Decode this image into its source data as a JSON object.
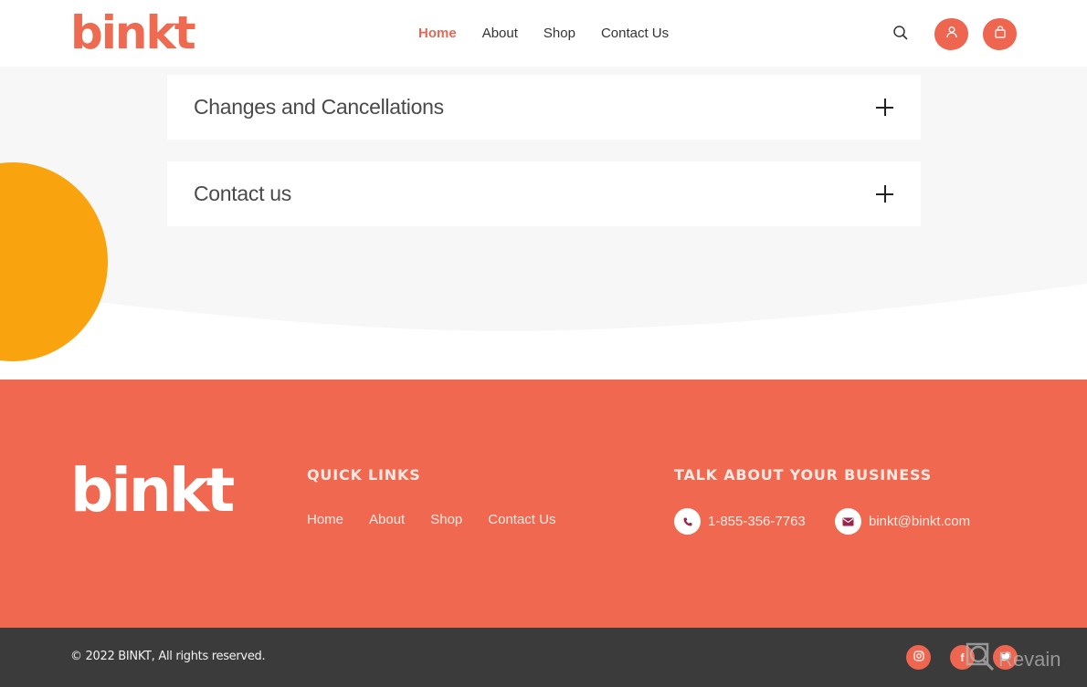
{
  "header": {
    "logo": "binkt",
    "nav": [
      {
        "label": "Home",
        "active": true
      },
      {
        "label": "About",
        "active": false
      },
      {
        "label": "Shop",
        "active": false
      },
      {
        "label": "Contact Us",
        "active": false
      }
    ],
    "icons": [
      "search-icon",
      "user-icon",
      "shopping-bag-icon"
    ]
  },
  "faq": {
    "items": [
      {
        "title": "Changes and Cancellations",
        "icon": "plus-icon"
      },
      {
        "title": "Contact us",
        "icon": "plus-icon"
      }
    ]
  },
  "footer": {
    "logo": "binkt",
    "quick_links": {
      "title": "QUICK LINKS",
      "links": [
        "Home",
        "About",
        "Shop",
        "Contact Us"
      ]
    },
    "business": {
      "title": "TALK ABOUT YOUR BUSINESS",
      "phone": "1-855-356-7763",
      "email": "binkt@binkt.com"
    },
    "copyright": "© 2022 BINKT, All rights reserved.",
    "social": [
      "instagram-icon",
      "facebook-icon",
      "twitter-icon"
    ],
    "watermark": "Revain"
  },
  "colors": {
    "brand": "#ee6650",
    "accent_blob": "#f9a40e",
    "footer_bg": "#f0684f",
    "bottom_bg": "#3b3b3c",
    "section_bg": "#f7f7f7"
  }
}
